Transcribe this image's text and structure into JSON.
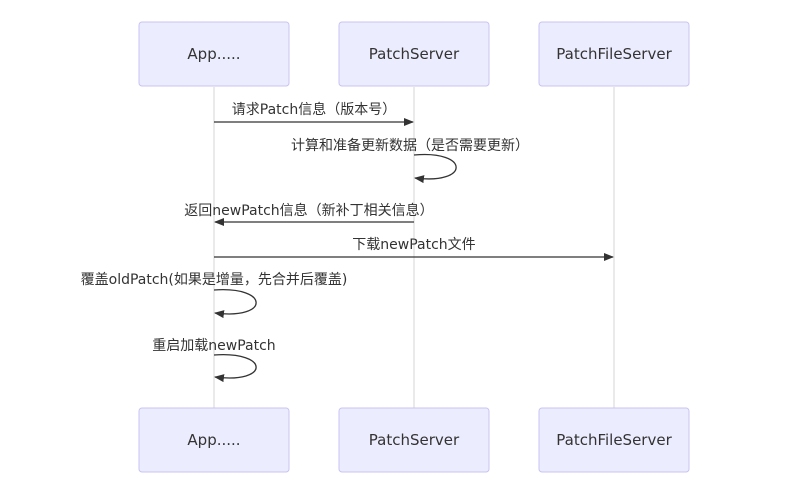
{
  "actors": [
    {
      "id": "app",
      "label": "App....."
    },
    {
      "id": "patchserver",
      "label": "PatchServer"
    },
    {
      "id": "patchfileserver",
      "label": "PatchFileServer"
    }
  ],
  "messages": [
    {
      "from": "app",
      "to": "patchserver",
      "text": "请求Patch信息（版本号）"
    },
    {
      "from": "patchserver",
      "to": "patchserver",
      "text": "计算和准备更新数据（是否需要更新）"
    },
    {
      "from": "patchserver",
      "to": "app",
      "text": "返回newPatch信息（新补丁相关信息）"
    },
    {
      "from": "app",
      "to": "patchfileserver",
      "text": "下载newPatch文件"
    },
    {
      "from": "app",
      "to": "app",
      "text": "覆盖oldPatch(如果是增量，先合并后覆盖)"
    },
    {
      "from": "app",
      "to": "app",
      "text": "重启加载newPatch"
    }
  ],
  "colors": {
    "actor_fill": "#ECECFF",
    "actor_border": "#C9C3F0",
    "lifeline": "#D6D6D6",
    "line": "#333333",
    "text": "#333333"
  }
}
